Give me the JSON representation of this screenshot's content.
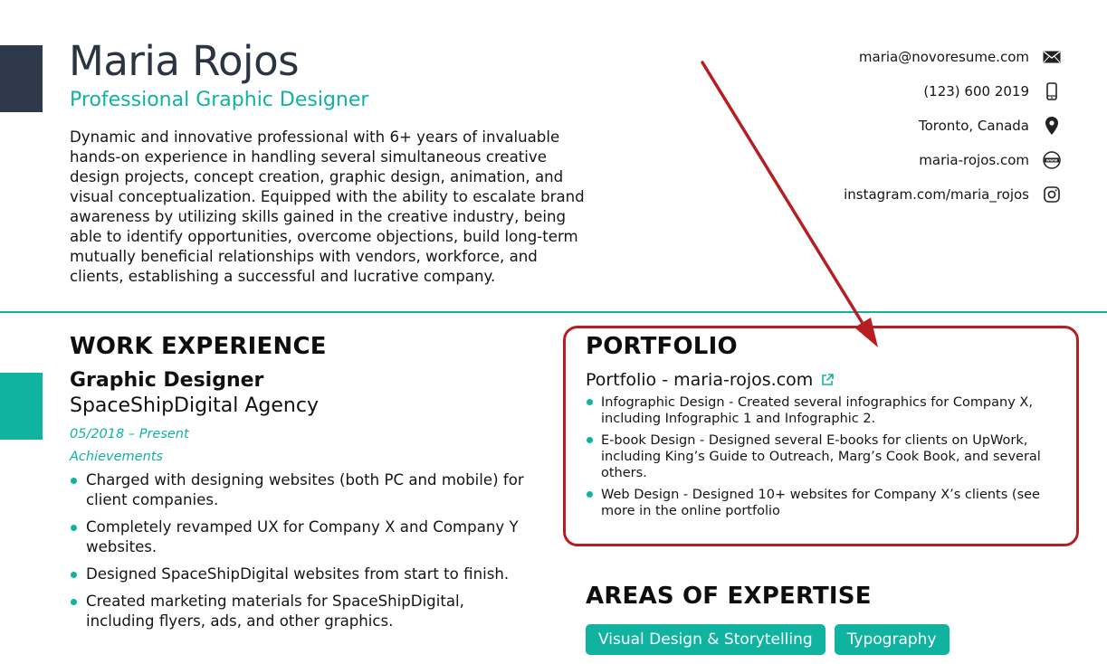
{
  "header": {
    "name": "Maria Rojos",
    "role": "Professional Graphic Designer",
    "summary": "Dynamic and innovative professional with 6+ years of invaluable hands-on experience in handling several simultaneous creative design projects, concept creation, graphic design, animation, and visual conceptualization. Equipped with the ability to escalate brand awareness by utilizing skills gained in the creative industry, being able to identify opportunities, overcome objections, build long-term mutually beneficial relationships with vendors, workforce, and clients, establishing a successful and lucrative company."
  },
  "contacts": [
    {
      "text": "maria@novoresume.com",
      "icon": "envelope-icon"
    },
    {
      "text": "(123) 600 2019",
      "icon": "phone-icon"
    },
    {
      "text": "Toronto, Canada",
      "icon": "location-pin-icon"
    },
    {
      "text": "maria-rojos.com",
      "icon": "www-globe-icon"
    },
    {
      "text": "instagram.com/maria_rojos",
      "icon": "instagram-icon"
    }
  ],
  "work_experience": {
    "section_title": "WORK EXPERIENCE",
    "job_title": "Graphic Designer",
    "company": "SpaceShipDigital Agency",
    "dates": "05/2018 – Present",
    "achievements_label": "Achievements",
    "achievements": [
      "Charged with designing websites (both PC and mobile) for client companies.",
      "Completely revamped UX for Company X and Company Y websites.",
      "Designed SpaceShipDigital websites from start to finish.",
      "Created marketing materials for SpaceShipDigital, including flyers, ads, and other graphics."
    ]
  },
  "portfolio": {
    "section_title": "PORTFOLIO",
    "link_text": "Portfolio - maria-rojos.com",
    "items": [
      "Infographic Design - Created several infographics for Company X, including Infographic 1 and Infographic 2.",
      "E-book Design - Designed several E-books for clients on UpWork, including King’s Guide to Outreach, Marg’s Cook Book, and several others.",
      "Web Design - Designed 10+ websites for Company X’s clients (see more in the online portfolio"
    ]
  },
  "expertise": {
    "section_title": "AREAS OF EXPERTISE",
    "tags": [
      "Visual Design & Storytelling",
      "Typography"
    ]
  },
  "colors": {
    "accent": "#10b39f",
    "dark_block": "#2e3a4b",
    "highlight_red": "#b51f24"
  }
}
